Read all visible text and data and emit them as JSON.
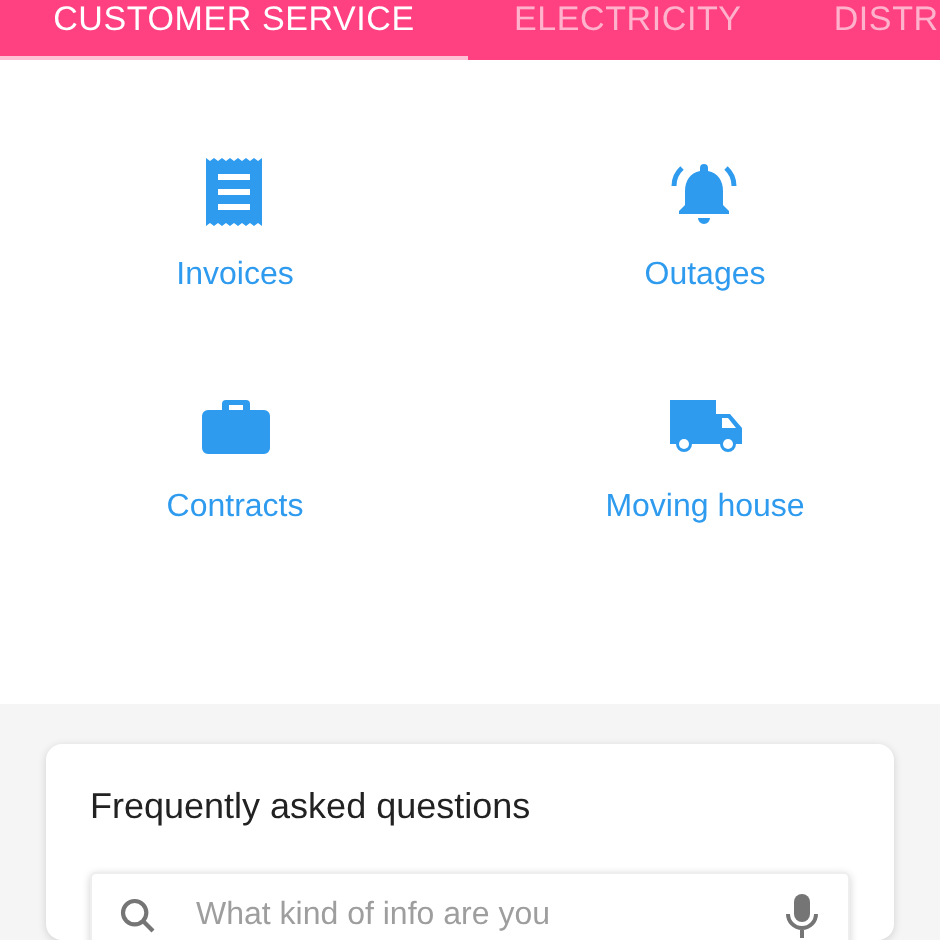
{
  "tabs": [
    {
      "label": "CUSTOMER SERVICE",
      "selected": true
    },
    {
      "label": "ELECTRICITY",
      "selected": false
    },
    {
      "label": "DISTR",
      "selected": false
    }
  ],
  "shortcuts": [
    {
      "kind": "receipt",
      "label": "Invoices"
    },
    {
      "kind": "bell",
      "label": "Outages"
    },
    {
      "kind": "briefcase",
      "label": "Contracts"
    },
    {
      "kind": "truck",
      "label": "Moving house"
    }
  ],
  "faq": {
    "title": "Frequently asked questions",
    "search": {
      "placeholder": "What kind of info are you"
    }
  }
}
